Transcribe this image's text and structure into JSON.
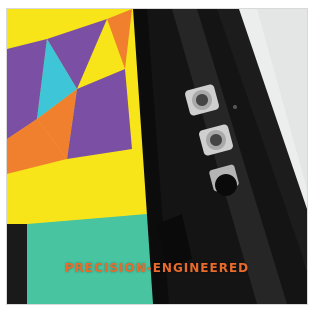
{
  "caption": "PRECISION-ENGINEERED",
  "image": {
    "subject": "black-stand-with-colorful-geometric-panel-and-knobs"
  },
  "colors": {
    "panel_yellow": "#f7e51a",
    "panel_purple": "#7b4fa3",
    "panel_cyan": "#3ec6d8",
    "panel_orange": "#f0802e",
    "panel_green": "#48c4a0",
    "stand_black": "#151515",
    "background": "#f1f2f2",
    "caption": "#e86b2c"
  }
}
